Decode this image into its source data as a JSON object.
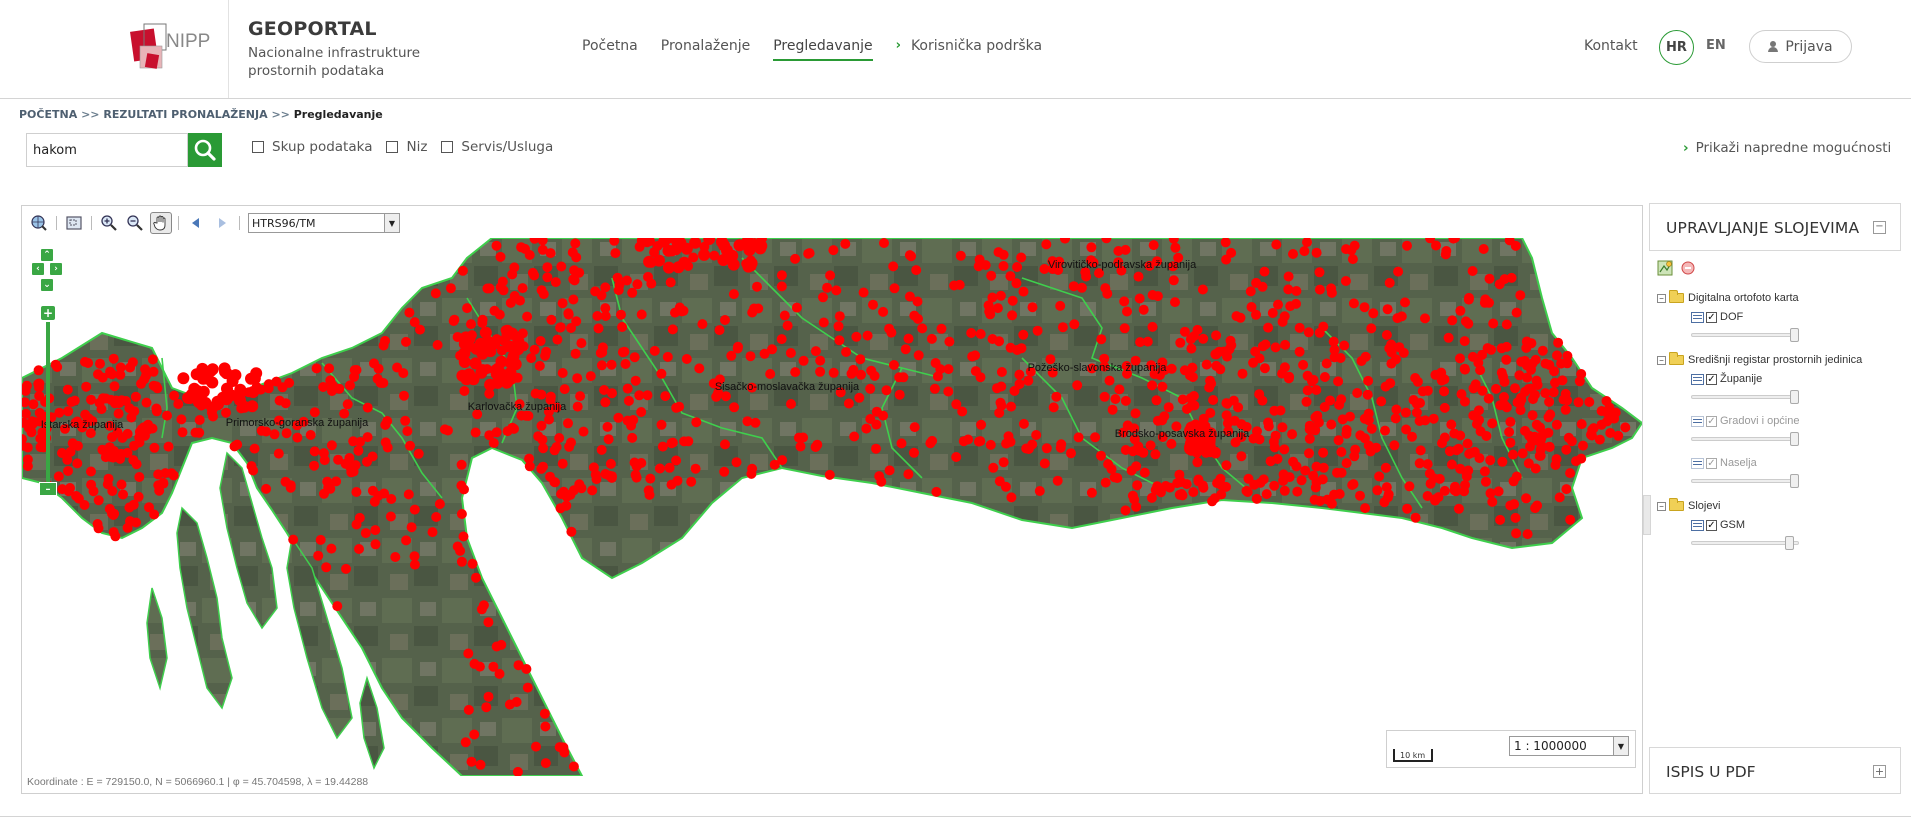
{
  "header": {
    "logo_text": "NIPP",
    "title": "GEOPORTAL",
    "subtitle": "Nacionalne infrastrukture prostornih podataka",
    "nav": [
      {
        "label": "Početna"
      },
      {
        "label": "Pronalaženje"
      },
      {
        "label": "Pregledavanje",
        "active": true
      },
      {
        "label": "Korisnička podrška"
      }
    ],
    "kontakt": "Kontakt",
    "lang_hr": "HR",
    "lang_en": "EN",
    "login": "Prijava"
  },
  "breadcrumb": {
    "items": [
      "POČETNA",
      "REZULTATI PRONALAŽENJA"
    ],
    "separator": ">>",
    "current": "Pregledavanje"
  },
  "search": {
    "value": "hakom",
    "filters": [
      "Skup podataka",
      "Niz",
      "Servis/Usluga"
    ],
    "advanced": "Prikaži napredne mogućnosti"
  },
  "map": {
    "crs": "HTRS96/TM",
    "scale": "1 : 1000000",
    "scalebar_label": "10 km",
    "coords": "Koordinate : E = 729150.0, N = 5066960.1 | φ = 45.704598, λ = 19.44288",
    "labels": [
      "Virovitičko-podravska županija",
      "Sisačko-moslavačka županija",
      "Požeško-slavonska županija",
      "Karlovačka županija",
      "Primorsko-goranska županija",
      "Istarska županija",
      "Brodsko-posavska županija"
    ],
    "colors": {
      "points": "#ff0000",
      "borders": "#3fcf4d",
      "land": "#51604a"
    }
  },
  "layers": {
    "title": "UPRAVLJANJE SLOJEVIMA",
    "groups": [
      {
        "name": "Digitalna ortofoto karta",
        "layers": [
          {
            "name": "DOF",
            "checked": true,
            "enabled": true,
            "opacity": 1.0
          }
        ]
      },
      {
        "name": "Središnji registar prostornih jedinica",
        "layers": [
          {
            "name": "Županije",
            "checked": true,
            "enabled": true,
            "opacity": 1.0
          },
          {
            "name": "Gradovi i općine",
            "checked": true,
            "enabled": false,
            "opacity": 1.0
          },
          {
            "name": "Naselja",
            "checked": true,
            "enabled": false,
            "opacity": 1.0
          }
        ]
      },
      {
        "name": "Slojevi",
        "layers": [
          {
            "name": "GSM",
            "checked": true,
            "enabled": true,
            "opacity": 0.95
          }
        ]
      }
    ]
  },
  "pdf": {
    "title": "ISPIS U PDF"
  }
}
